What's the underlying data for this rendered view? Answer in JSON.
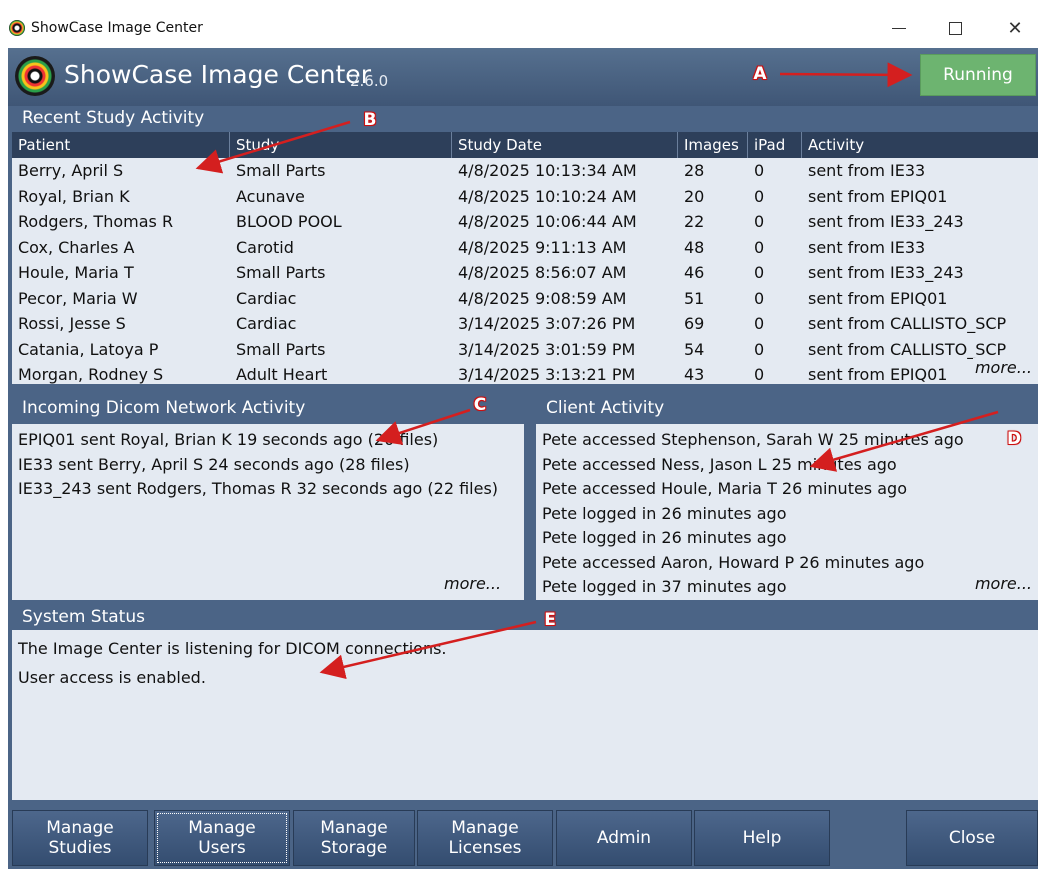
{
  "window": {
    "title": "ShowCase Image Center",
    "controls": {
      "minimize": "—",
      "maximize": "",
      "close": "✕"
    }
  },
  "header": {
    "app_name": "ShowCase Image Center",
    "version": "2.6.0",
    "status_button": "Running",
    "status_color": "#6db470"
  },
  "recent_study": {
    "title": "Recent Study Activity",
    "columns": [
      "Patient",
      "Study",
      "Study Date",
      "Images",
      "iPad",
      "Activity"
    ],
    "rows": [
      [
        "Berry, April S",
        "Small Parts",
        "4/8/2025 10:13:34 AM",
        "28",
        "0",
        "sent from IE33"
      ],
      [
        "Royal, Brian K",
        "Acunave",
        "4/8/2025 10:10:24 AM",
        "20",
        "0",
        "sent from EPIQ01"
      ],
      [
        "Rodgers, Thomas R",
        "BLOOD POOL",
        "4/8/2025 10:06:44 AM",
        "22",
        "0",
        "sent from IE33_243"
      ],
      [
        "Cox, Charles A",
        "Carotid",
        "4/8/2025 9:11:13 AM",
        "48",
        "0",
        "sent from IE33"
      ],
      [
        "Houle, Maria T",
        "Small Parts",
        "4/8/2025 8:56:07 AM",
        "46",
        "0",
        "sent from IE33_243"
      ],
      [
        "Pecor, Maria W",
        "Cardiac",
        "4/8/2025 9:08:59 AM",
        "51",
        "0",
        "sent from EPIQ01"
      ],
      [
        "Rossi, Jesse S",
        "Cardiac",
        "3/14/2025 3:07:26 PM",
        "69",
        "0",
        "sent from CALLISTO_SCP"
      ],
      [
        "Catania, Latoya P",
        "Small Parts",
        "3/14/2025 3:01:59 PM",
        "54",
        "0",
        "sent from CALLISTO_SCP"
      ],
      [
        "Morgan, Rodney S",
        "Adult Heart",
        "3/14/2025 3:13:21 PM",
        "43",
        "0",
        "sent from EPIQ01"
      ]
    ],
    "more": "more..."
  },
  "incoming": {
    "title": "Incoming Dicom Network Activity",
    "lines": [
      "EPIQ01 sent Royal, Brian K 19 seconds ago (20 files)",
      "IE33 sent Berry, April S 24 seconds ago (28 files)",
      "IE33_243 sent Rodgers, Thomas R 32 seconds ago (22 files)"
    ],
    "more": "more..."
  },
  "client": {
    "title": "Client Activity",
    "lines": [
      "Pete accessed Stephenson, Sarah W 25 minutes ago",
      "Pete accessed Ness, Jason L 25 minutes ago",
      "Pete accessed Houle, Maria T 26 minutes ago",
      "Pete logged in 26 minutes ago",
      "Pete logged in 26 minutes ago",
      "Pete accessed Aaron, Howard P 26 minutes ago",
      "Pete logged in 37 minutes ago"
    ],
    "more": "more..."
  },
  "system_status": {
    "title": "System Status",
    "lines": [
      "The Image Center is listening for DICOM connections.",
      "User access is enabled."
    ]
  },
  "buttons": {
    "manage_studies": "Manage\nStudies",
    "manage_users": "Manage\nUsers",
    "manage_storage": "Manage\nStorage",
    "manage_licenses": "Manage\nLicenses",
    "admin": "Admin",
    "help": "Help",
    "close": "Close"
  },
  "annotations": {
    "a": "A",
    "b": "B",
    "c": "C",
    "d": "D",
    "e": "E",
    "color": "#d41f1f"
  }
}
